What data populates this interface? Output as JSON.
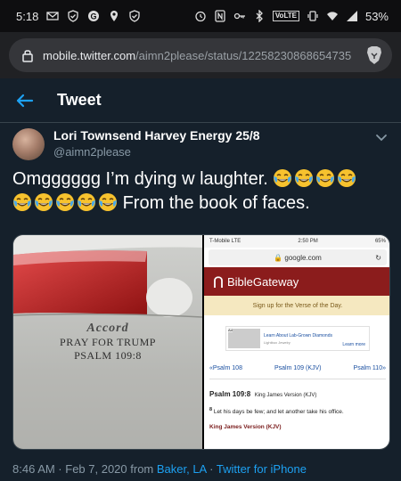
{
  "status_bar": {
    "time": "5:18",
    "volte": "VoLTE",
    "battery": "53%"
  },
  "browser": {
    "url_host": "mobile.twitter.com",
    "url_path": "/aimn2please/status/12258230868654735"
  },
  "header": {
    "title": "Tweet"
  },
  "tweet": {
    "display_name": "Lori Townsend Harvey Energy 25/8",
    "handle": "@aimn2please",
    "text_line1": "Omgggggg I’m dying w laughter.",
    "text_line2": "From the book of faces.",
    "emoji_name": "face-with-tears-of-joy"
  },
  "media": {
    "car": {
      "badge": "Accord",
      "line1": "PRAY FOR TRUMP",
      "line2": "PSALM 109:8"
    },
    "phone": {
      "carrier": "T-Mobile  LTE",
      "time": "2:50 PM",
      "battery": "65%",
      "url": "google.com",
      "site_name": "BibleGateway",
      "signup": "Sign up for the Verse of the Day.",
      "ad_tag": "Ad",
      "ad_title": "Learn About Lab-Grown Diamonds",
      "ad_sub": "Lightbox Jewelry",
      "ad_button": "Learn more",
      "nav_prev": "«Psalm 108",
      "nav_mid": "Psalm 109 (KJV)",
      "nav_next": "Psalm 110»",
      "ref": "Psalm 109:8",
      "ref_version": "King James Version (KJV)",
      "verse_num": "8",
      "verse_text": "Let his days be few; and let another take his office.",
      "version_footer": "King James Version (KJV)"
    }
  },
  "meta": {
    "timestamp": "8:46 AM · Feb 7, 2020 from ",
    "location": "Baker, LA",
    "sep": " · ",
    "client": "Twitter for iPhone"
  },
  "colors": {
    "background": "#15202b",
    "accent": "#1da1f2",
    "muted": "#8899a6"
  }
}
